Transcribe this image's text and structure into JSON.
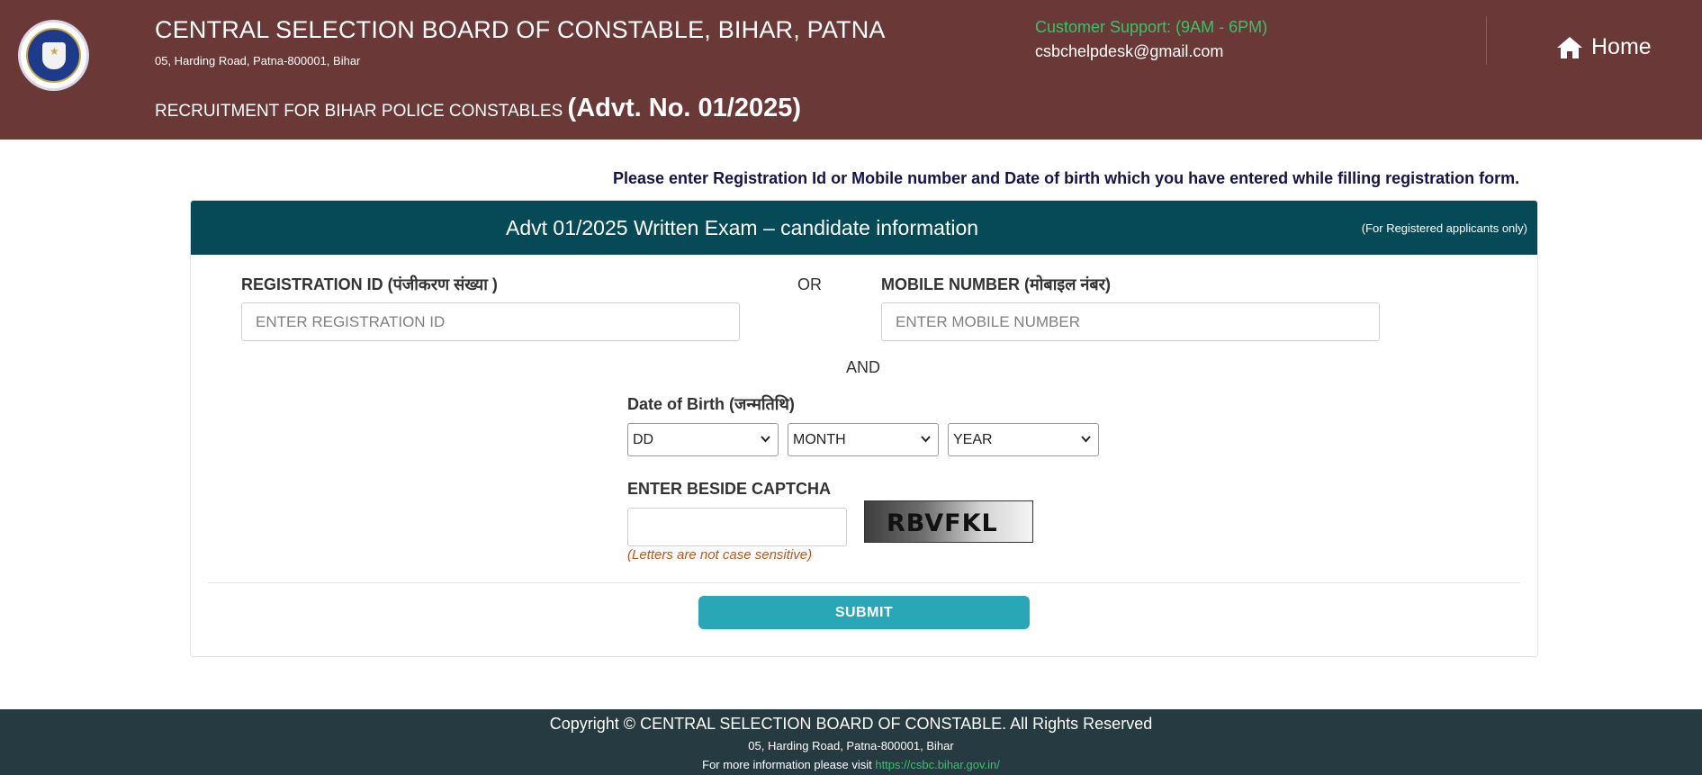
{
  "header": {
    "org_title": "CENTRAL SELECTION BOARD OF CONSTABLE, BIHAR, PATNA",
    "address": "05, Harding Road, Patna-800001, Bihar",
    "recruitment_prefix": "RECRUITMENT FOR BIHAR POLICE CONSTABLES",
    "recruitment_advt": "(Advt. No. 01/2025)",
    "support_label": "Customer Support: (9AM - 6PM)",
    "support_email": "csbchelpdesk@gmail.com",
    "home_label": "Home",
    "home_icon": "home-icon",
    "support_color": "#35c46a",
    "header_bg": "#6b3838"
  },
  "instruction": "Please enter Registration Id or Mobile number and Date of birth which you have entered while filling registration form.",
  "card": {
    "title": "Advt 01/2025 Written Exam – candidate information",
    "note": "(For Registered applicants only)",
    "header_bg": "#074a57"
  },
  "form": {
    "registration_label": "REGISTRATION ID (पंजीकरण संख्या )",
    "registration_placeholder": "ENTER REGISTRATION ID",
    "or_text": "OR",
    "mobile_label": "MOBILE NUMBER (मोबाइल नंबर)",
    "mobile_placeholder": "ENTER MOBILE NUMBER",
    "and_text": "AND",
    "dob_label": "Date of Birth (जन्मतिथि)",
    "dob_day": "DD",
    "dob_month": "MONTH",
    "dob_year": "YEAR",
    "captcha_label": "ENTER BESIDE CAPTCHA",
    "captcha_text": "RBVFKL",
    "captcha_hint": "(Letters are not case sensitive)",
    "submit_label": "SUBMIT",
    "submit_color": "#2aa7b7",
    "hint_color": "#c0541a"
  },
  "footer": {
    "copyright": "Copyright © CENTRAL SELECTION BOARD OF CONSTABLE. All Rights Reserved",
    "address": "05, Harding Road, Patna-800001, Bihar",
    "more_prefix": "For more information please visit",
    "link_text": "https://csbc.bihar.gov.in/",
    "footer_bg": "#263a41"
  }
}
